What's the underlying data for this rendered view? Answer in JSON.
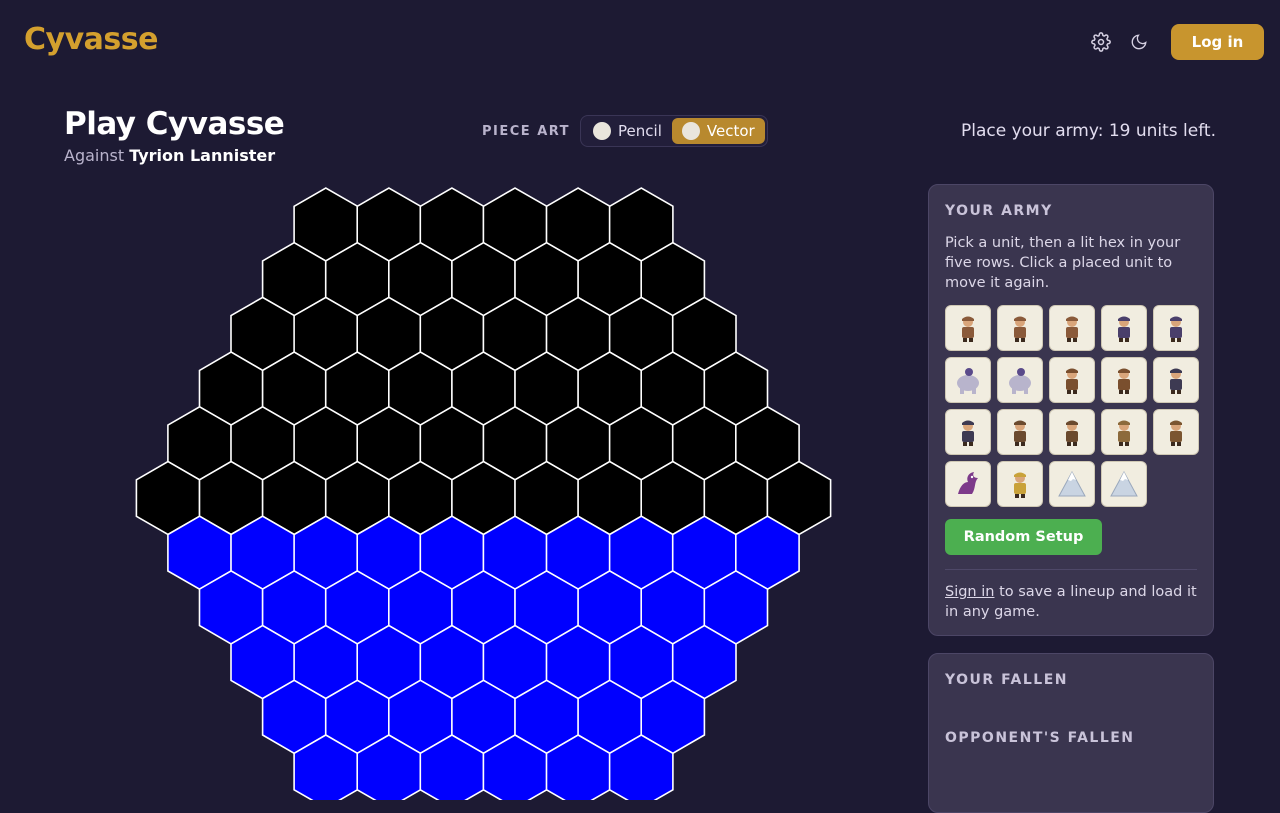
{
  "header": {
    "logo": "Cyvasse",
    "login_label": "Log in",
    "icons": [
      "gear-icon",
      "moon-icon"
    ]
  },
  "game": {
    "title": "Play Cyvasse",
    "against_label": "Against",
    "opponent": "Tyrion Lannister",
    "status": "Place your army: 19 units left."
  },
  "piece_art": {
    "label": "PIECE ART",
    "options": [
      {
        "label": "Pencil",
        "active": false
      },
      {
        "label": "Vector",
        "active": true
      }
    ]
  },
  "board": {
    "colors": {
      "opponent": "#000000",
      "player": "#0000ff",
      "stroke": "#ffffff"
    },
    "opponent_rows": 6,
    "player_rows_visible": 5
  },
  "army": {
    "title": "YOUR ARMY",
    "instructions": "Pick a unit, then a lit hex in your five rows. Click a placed unit to move it again.",
    "units": [
      "rabble",
      "rabble",
      "rabble",
      "spearman",
      "spearman",
      "elephant",
      "elephant",
      "light-horse",
      "light-horse",
      "heavy-horse",
      "heavy-horse",
      "crossbowman",
      "crossbowman",
      "catapult",
      "trebuchet",
      "dragon",
      "king",
      "mountain",
      "mountain"
    ],
    "random_label": "Random Setup",
    "signin_link": "Sign in",
    "signin_rest": " to save a lineup and load it in any game."
  },
  "fallen": {
    "yours": "YOUR FALLEN",
    "opponent": "OPPONENT'S FALLEN"
  }
}
